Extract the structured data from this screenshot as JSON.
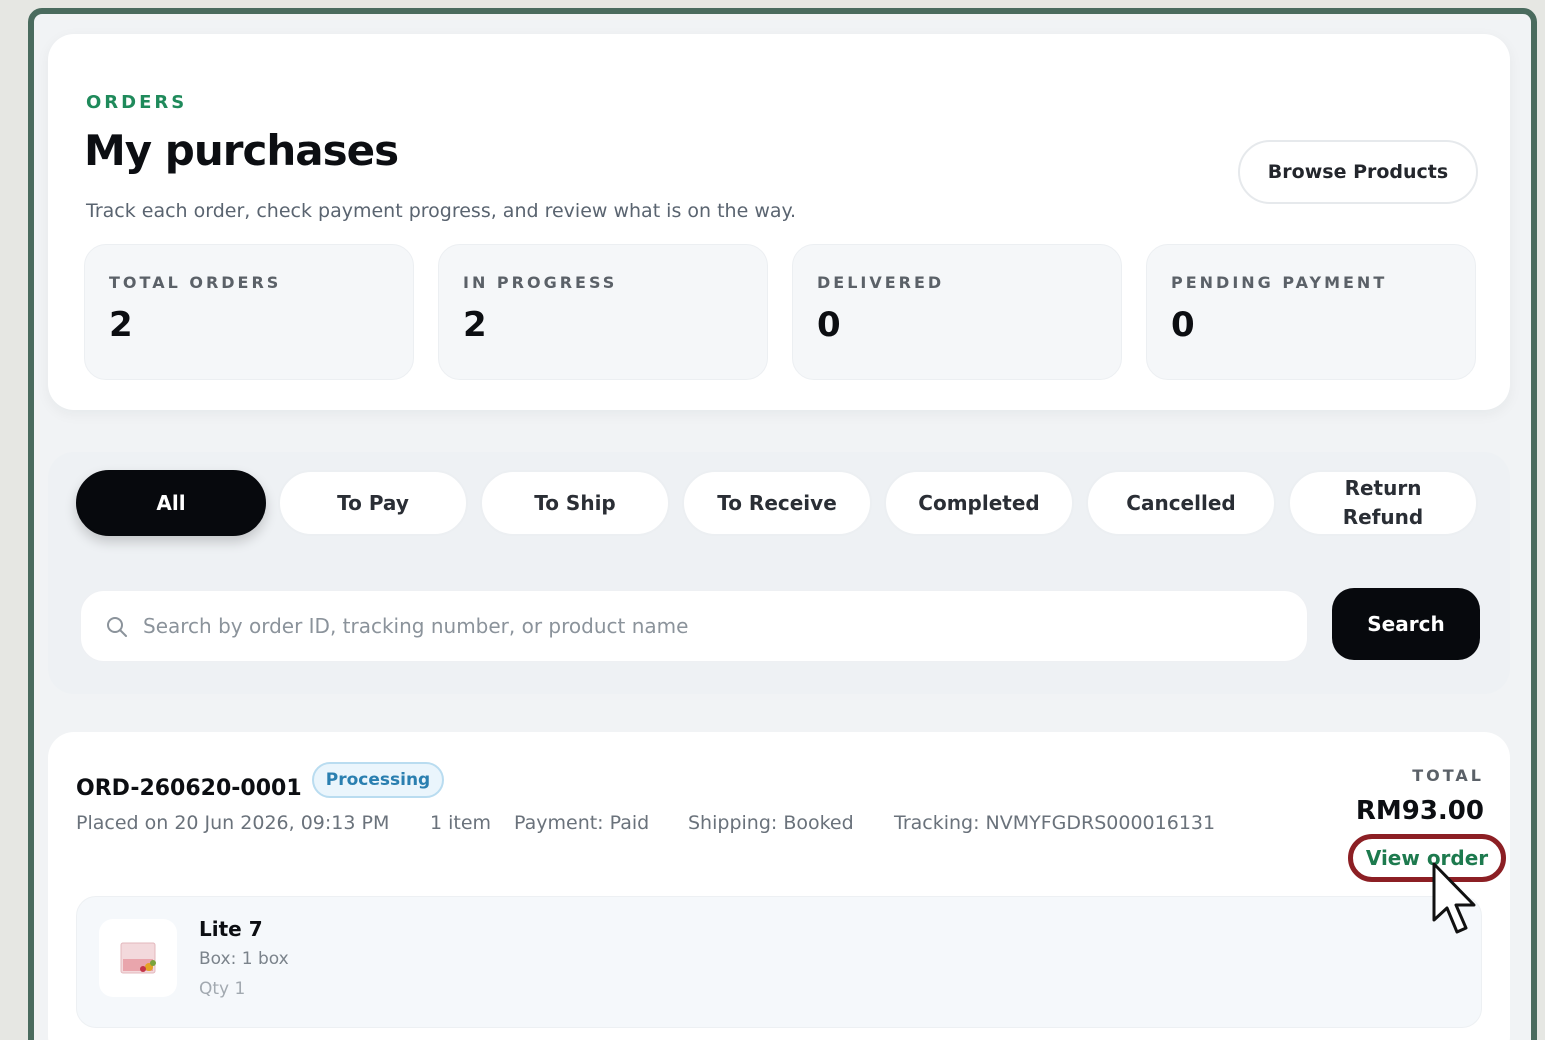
{
  "header": {
    "eyebrow": "ORDERS",
    "title": "My purchases",
    "subtitle": "Track each order, check payment progress, and review what is on the way.",
    "browse_label": "Browse Products"
  },
  "stats": [
    {
      "label": "TOTAL ORDERS",
      "value": "2"
    },
    {
      "label": "IN PROGRESS",
      "value": "2"
    },
    {
      "label": "DELIVERED",
      "value": "0"
    },
    {
      "label": "PENDING PAYMENT",
      "value": "0"
    }
  ],
  "tabs": [
    {
      "label": "All",
      "active": true
    },
    {
      "label": "To Pay"
    },
    {
      "label": "To Ship"
    },
    {
      "label": "To Receive"
    },
    {
      "label": "Completed"
    },
    {
      "label": "Cancelled"
    },
    {
      "label": "Return Refund"
    }
  ],
  "search": {
    "placeholder": "Search by order ID, tracking number, or product name",
    "button_label": "Search"
  },
  "order": {
    "id": "ORD-260620-0001",
    "status": "Processing",
    "placed": "Placed on 20 Jun 2026, 09:13 PM",
    "items_count": "1 item",
    "payment": "Payment: Paid",
    "shipping": "Shipping: Booked",
    "tracking": "Tracking: NVMYFGDRS000016131",
    "total_label": "TOTAL",
    "total_value": "RM93.00",
    "view_label": "View order",
    "item": {
      "name": "Lite 7",
      "variant": "Box: 1 box",
      "qty": "Qty 1"
    }
  },
  "colors": {
    "accent_green": "#1f8a5b",
    "frame": "#4a6b5e",
    "highlight_ring": "#8c1f24",
    "processing_badge": "#2a7fb0"
  }
}
